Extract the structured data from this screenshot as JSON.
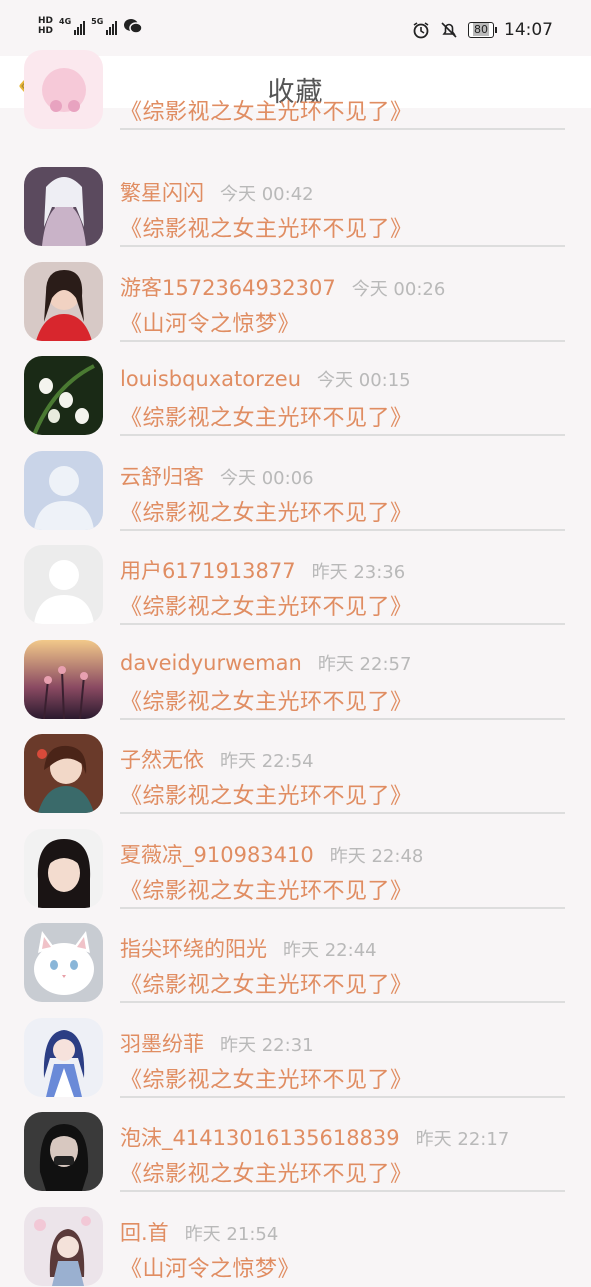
{
  "status": {
    "hd1": "HD",
    "hd2": "HD",
    "net1": "4G",
    "net2": "5G",
    "battery": "80",
    "time": "14:07"
  },
  "header": {
    "title": "收藏"
  },
  "colors": {
    "accent": "#e08d62",
    "back_arrow": "#e8b73b",
    "time_text": "#b9b9b9"
  },
  "items": [
    {
      "name": "",
      "time": "",
      "novel": "《综影视之女主光环不见了》"
    },
    {
      "name": "繁星闪闪",
      "time": "今天 00:42",
      "novel": "《综影视之女主光环不见了》"
    },
    {
      "name": "游客1572364932307",
      "time": "今天 00:26",
      "novel": "《山河令之惊梦》"
    },
    {
      "name": "louisbquxatorzeu",
      "time": "今天 00:15",
      "novel": "《综影视之女主光环不见了》"
    },
    {
      "name": "云舒归客",
      "time": "今天 00:06",
      "novel": "《综影视之女主光环不见了》"
    },
    {
      "name": "用户6171913877",
      "time": "昨天 23:36",
      "novel": "《综影视之女主光环不见了》"
    },
    {
      "name": "daveidyurweman",
      "time": "昨天 22:57",
      "novel": "《综影视之女主光环不见了》"
    },
    {
      "name": "子然无依",
      "time": "昨天 22:54",
      "novel": "《综影视之女主光环不见了》"
    },
    {
      "name": "夏薇凉_910983410",
      "time": "昨天 22:48",
      "novel": "《综影视之女主光环不见了》"
    },
    {
      "name": "指尖环绕的阳光",
      "time": "昨天 22:44",
      "novel": "《综影视之女主光环不见了》"
    },
    {
      "name": "羽墨纷菲",
      "time": "昨天 22:31",
      "novel": "《综影视之女主光环不见了》"
    },
    {
      "name": "泡沫_41413016135618839",
      "time": "昨天 22:17",
      "novel": "《综影视之女主光环不见了》"
    },
    {
      "name": "回.首",
      "time": "昨天 21:54",
      "novel": "《山河令之惊梦》"
    }
  ]
}
